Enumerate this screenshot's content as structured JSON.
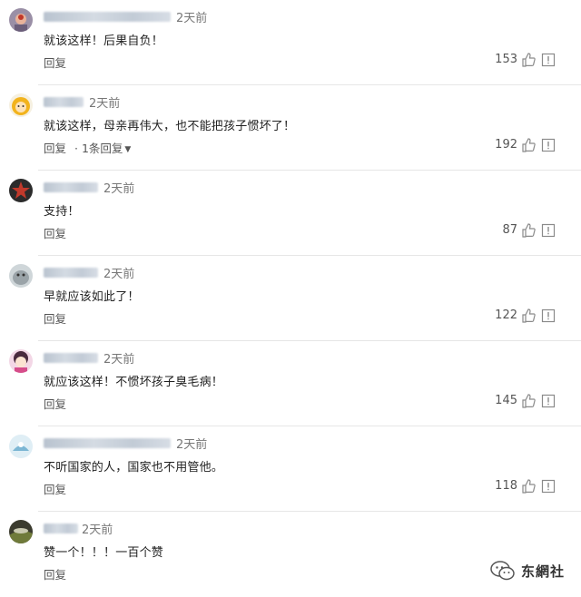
{
  "reply_label": "回复",
  "comments": [
    {
      "time": "2天前",
      "text": "就该这样！后果自负！",
      "likes": "153",
      "replies_label": ""
    },
    {
      "time": "2天前",
      "text": "就该这样，母亲再伟大，也不能把孩子惯坏了！",
      "likes": "192",
      "replies_label": "1条回复"
    },
    {
      "time": "2天前",
      "text": "支持！",
      "likes": "87",
      "replies_label": ""
    },
    {
      "time": "2天前",
      "text": "早就应该如此了！",
      "likes": "122",
      "replies_label": ""
    },
    {
      "time": "2天前",
      "text": "就应该这样！不惯坏孩子臭毛病！",
      "likes": "145",
      "replies_label": ""
    },
    {
      "time": "2天前",
      "text": "不听国家的人，国家也不用管他。",
      "likes": "118",
      "replies_label": ""
    },
    {
      "time": "2天前",
      "text": "赞一个！！！一百个赞",
      "likes": "",
      "replies_label": ""
    }
  ],
  "watermark": {
    "text": "东網社"
  },
  "colors": {
    "text": "#222222",
    "muted": "#777777",
    "divider": "#e6e6e6",
    "icon": "#8a8a8a"
  }
}
